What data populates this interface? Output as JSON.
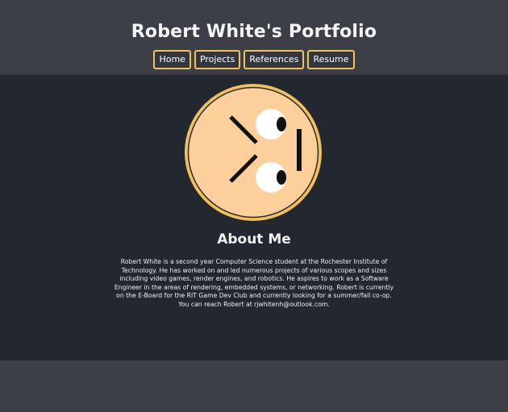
{
  "header": {
    "title": "Robert White's Portfolio"
  },
  "nav": {
    "items": [
      {
        "label": "Home"
      },
      {
        "label": "Projects"
      },
      {
        "label": "References"
      },
      {
        "label": "Resume"
      }
    ]
  },
  "avatar": {
    "icon": "cartoon-face-logo",
    "face_color": "#fdcf9a",
    "ring_color": "#f2c15c"
  },
  "about": {
    "heading": "About Me",
    "text": "Robert White is a second year Computer Science student at the Rochester Institute of Technology. He has worked on and led numerous projects of various scopes and sizes including video games, render engines, and robotics. He aspires to work as a Software Engineer in the areas of rendering, embedded systems, or networking. Robert is currently on the E-Board for the RIT Game Dev Club and currently looking for a summer/fall co-op. You can reach Robert at rjwhitenh@outlook.com."
  },
  "colors": {
    "header_bg": "#3c3f48",
    "body_bg": "#23272f",
    "accent": "#f2c15c",
    "text": "#f0f0f0"
  }
}
